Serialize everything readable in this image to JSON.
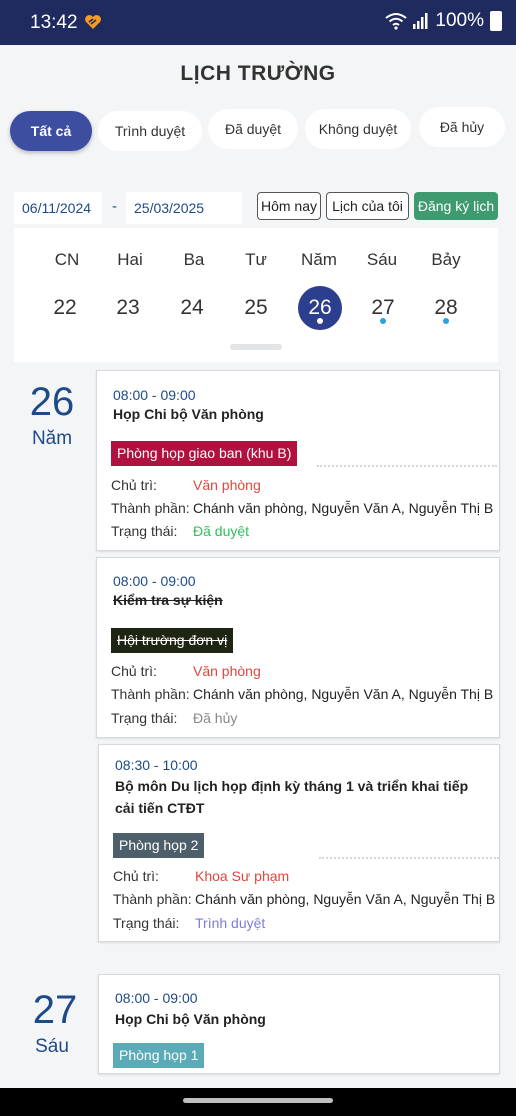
{
  "status_bar": {
    "time": "13:42",
    "battery": "100%"
  },
  "page_title": "LỊCH TRƯỜNG",
  "filter_tabs": [
    {
      "label": "Tất cả",
      "active": true
    },
    {
      "label": "Trình duyệt",
      "active": false
    },
    {
      "label": "Đã duyệt",
      "active": false
    },
    {
      "label": "Không duyệt",
      "active": false
    },
    {
      "label": "Đã hủy",
      "active": false
    }
  ],
  "date_range": {
    "from": "06/11/2024",
    "separator": "-",
    "to": "25/03/2025"
  },
  "actions": {
    "today": "Hôm nay",
    "my_schedule": "Lịch của tôi",
    "register": "Đăng ký lịch"
  },
  "week": {
    "days": [
      {
        "name": "CN",
        "num": "22"
      },
      {
        "name": "Hai",
        "num": "23"
      },
      {
        "name": "Ba",
        "num": "24"
      },
      {
        "name": "Tư",
        "num": "25"
      },
      {
        "name": "Năm",
        "num": "26",
        "selected": true,
        "dot": true
      },
      {
        "name": "Sáu",
        "num": "27",
        "dot": true
      },
      {
        "name": "Bảy",
        "num": "28",
        "dot": true
      }
    ]
  },
  "labels": {
    "host": "Chủ trì:",
    "members": "Thành phần:",
    "status": "Trạng thái:"
  },
  "groups": [
    {
      "day_num": "26",
      "day_name": "Năm",
      "events": [
        {
          "time": "08:00 - 09:00",
          "title": "Họp Chi bộ Văn phòng",
          "room": "Phòng họp giao ban (khu B)",
          "room_color": "#b0113f",
          "host": "Văn phòng",
          "members": "Chánh văn phòng, Nguyễn Văn A, Nguyễn Thị B",
          "status": "Đã duyệt"
        },
        {
          "time": "08:00 - 09:00",
          "title": "Kiểm tra sự kiện",
          "room": "Hội trường đơn vị",
          "room_color": "#1e2512",
          "host": "Văn phòng",
          "members": "Chánh văn phòng, Nguyễn Văn A, Nguyễn Thị B",
          "status": "Đã hủy"
        },
        {
          "time": "08:30 - 10:00",
          "title": "Bộ môn Du lịch họp định kỳ tháng 1 và triển khai tiếp cải tiến CTĐT",
          "room": "Phòng họp 2",
          "room_color": "#4d5f6b",
          "host": "Khoa Sư phạm",
          "members": "Chánh văn phòng, Nguyễn Văn A, Nguyễn Thị B",
          "status": "Trình duyệt"
        }
      ]
    },
    {
      "day_num": "27",
      "day_name": "Sáu",
      "events": [
        {
          "time": "08:00 - 09:00",
          "title": "Họp Chi bộ Văn phòng",
          "room": "Phòng họp 1",
          "room_color": "#5aaab7"
        }
      ]
    }
  ],
  "colors": {
    "primary": "#2c3f8f",
    "status_approved": "#2fbf5a",
    "status_cancelled": "#888888",
    "status_pending": "#7c7cd6",
    "host": "#e0463d"
  }
}
